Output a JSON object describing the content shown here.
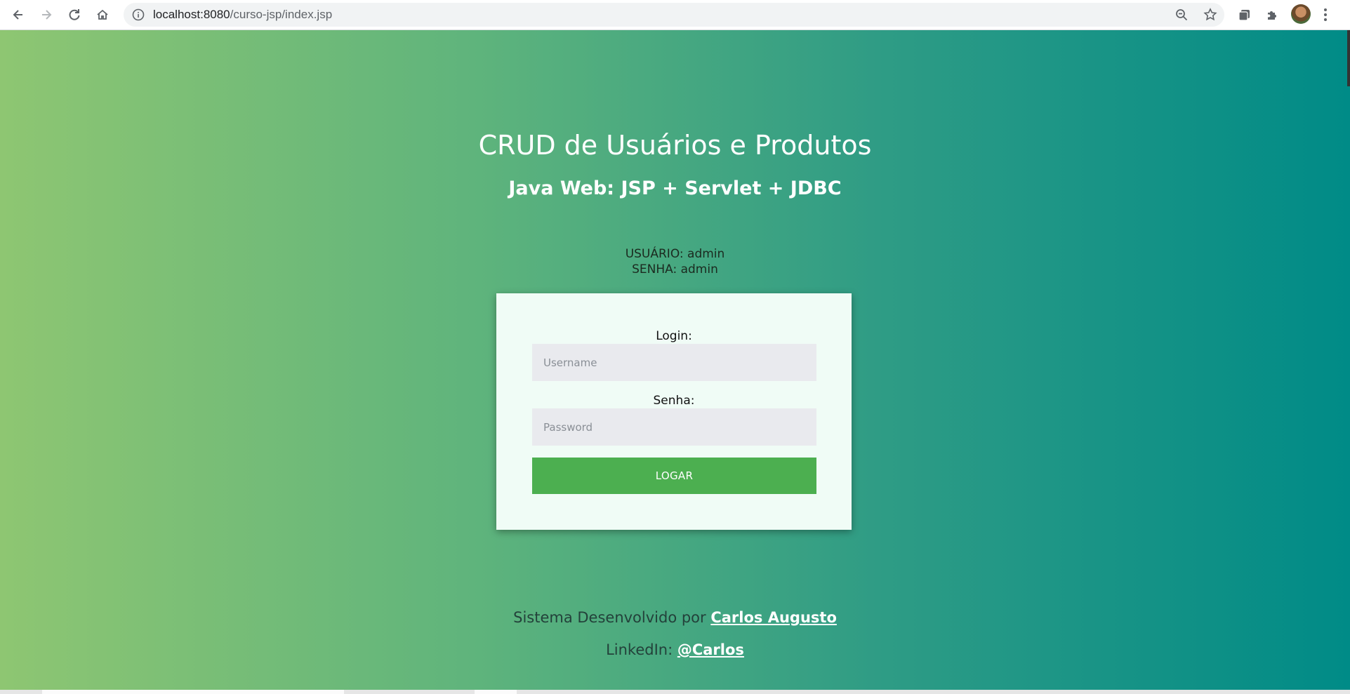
{
  "browser": {
    "url_host": "localhost:8080",
    "url_path": "/curso-jsp/index.jsp",
    "icons": [
      "back-arrow-icon",
      "forward-arrow-icon",
      "reload-icon",
      "home-icon",
      "info-icon",
      "zoom-out-icon",
      "star-icon",
      "tab-search-icon",
      "extensions-icon",
      "profile-avatar-icon",
      "menu-dots-icon"
    ]
  },
  "page": {
    "title": "CRUD de Usuários e Produtos",
    "subtitle": "Java Web: JSP + Servlet + JDBC",
    "credentials": {
      "user_line": "USUÁRIO: admin",
      "pass_line": "SENHA: admin"
    },
    "form": {
      "login_label": "Login:",
      "username_placeholder": "Username",
      "password_label": "Senha:",
      "password_placeholder": "Password",
      "submit_label": "LOGAR"
    },
    "footer": {
      "dev_prefix": "Sistema Desenvolvido por ",
      "dev_name": "Carlos Augusto",
      "linkedin_prefix": "LinkedIn: ",
      "linkedin_handle": "@Carlos"
    }
  },
  "colors": {
    "gradient_start": "#8ec672",
    "gradient_end": "#008b87",
    "button": "#4caf50",
    "card": "#f0fcf6"
  }
}
